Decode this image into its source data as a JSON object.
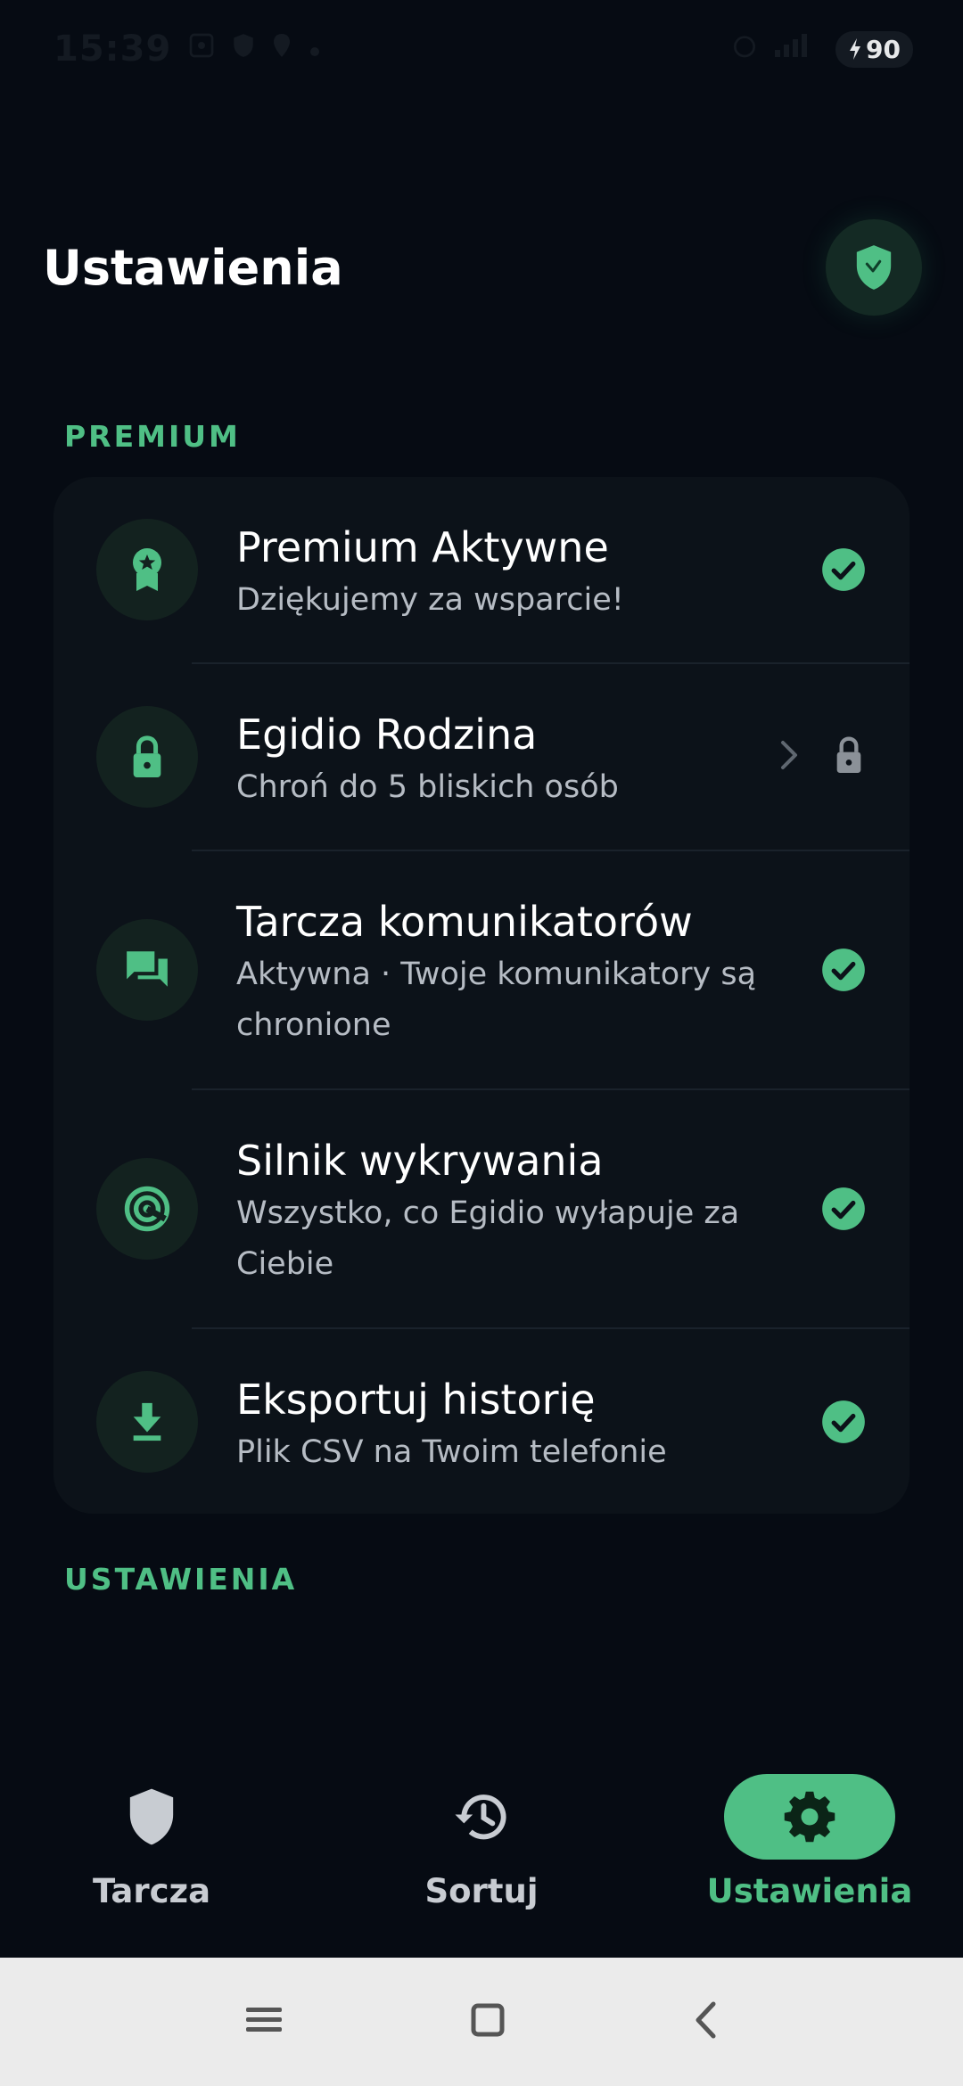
{
  "status_bar": {
    "time": "15:39",
    "battery": "90"
  },
  "header": {
    "title": "Ustawienia",
    "badge_icon": "shield-check-icon"
  },
  "sections": {
    "premium_label": "PREMIUM",
    "settings_label": "USTAWIENIA"
  },
  "premium_items": [
    {
      "title": "Premium Aktywne",
      "subtitle": "Dziękujemy za wsparcie!",
      "icon": "award-icon",
      "status": "check"
    },
    {
      "title": "Egidio Rodzina",
      "subtitle": "Chroń do 5 bliskich osób",
      "icon": "lock-icon",
      "status": "locked"
    },
    {
      "title": "Tarcza komunikatorów",
      "subtitle": "Aktywna · Twoje komunikatory są chronione",
      "icon": "chat-icon",
      "status": "check"
    },
    {
      "title": "Silnik wykrywania",
      "subtitle": "Wszystko, co Egidio wyłapuje za Ciebie",
      "icon": "radar-icon",
      "status": "check"
    },
    {
      "title": "Eksportuj historię",
      "subtitle": "Plik CSV na Twoim telefonie",
      "icon": "download-icon",
      "status": "check"
    }
  ],
  "bottom_nav": {
    "items": [
      {
        "label": "Tarcza",
        "icon": "shield-icon"
      },
      {
        "label": "Sortuj",
        "icon": "history-icon"
      },
      {
        "label": "Ustawienia",
        "icon": "gear-icon",
        "active": true
      }
    ]
  },
  "colors": {
    "accent": "#4fbf85",
    "background": "#060b13",
    "card": "#0c1219"
  }
}
